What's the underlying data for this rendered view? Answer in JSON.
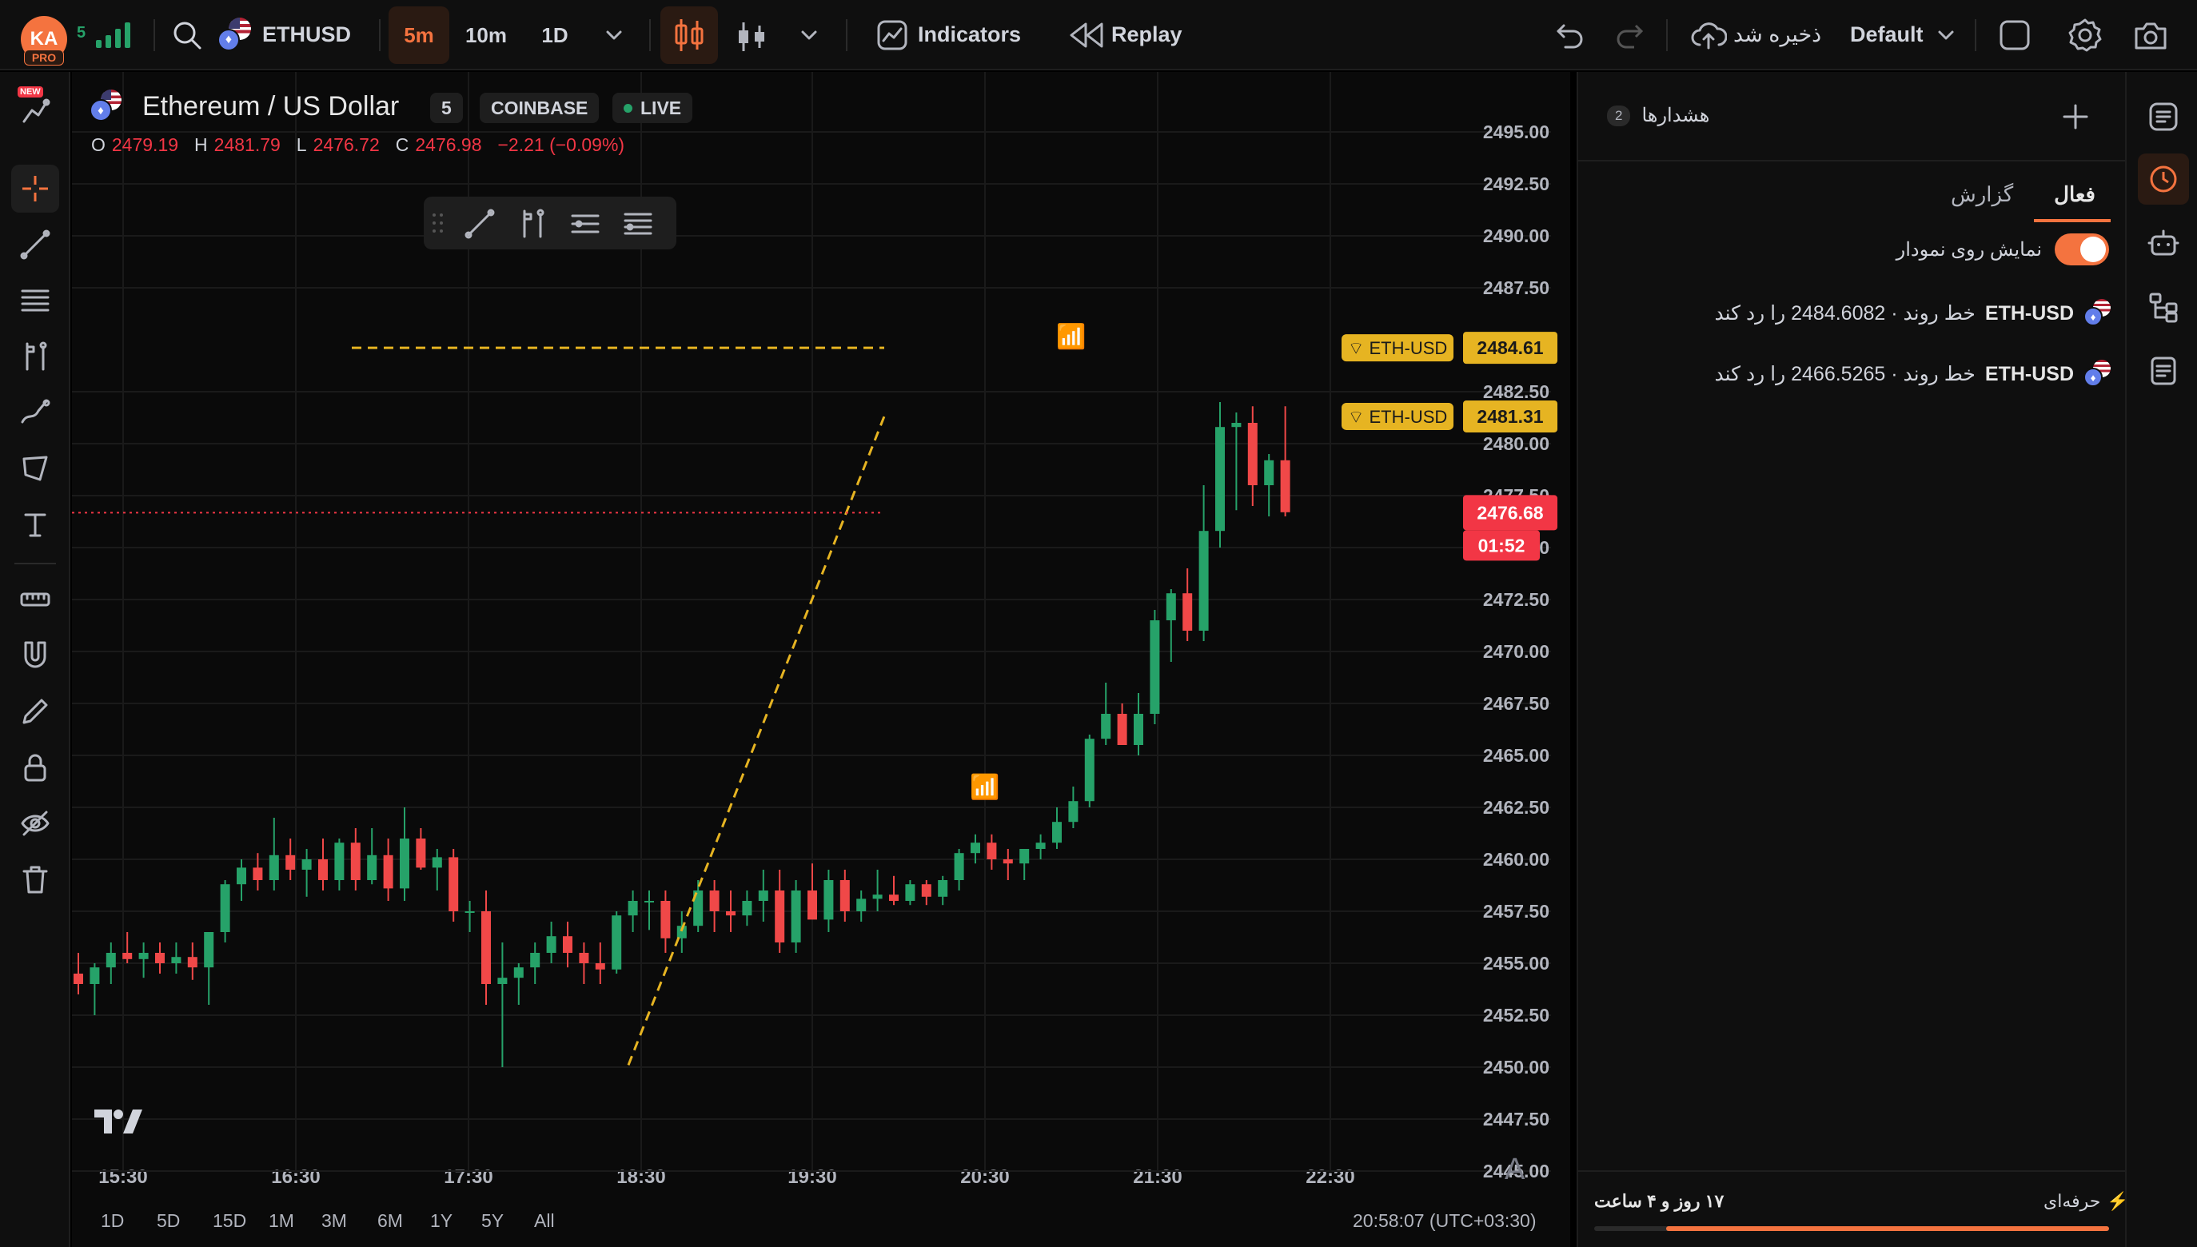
{
  "topbar": {
    "avatar_initials": "KA",
    "avatar_badge": "PRO",
    "signal_count": "5",
    "symbol": "ETHUSD",
    "intervals": [
      "5m",
      "10m",
      "1D"
    ],
    "indicators_label": "Indicators",
    "replay_label": "Replay",
    "save_label": "ذخیره شد",
    "layout_label": "Default"
  },
  "legend": {
    "title": "Ethereum / US Dollar",
    "interval": "5",
    "exchange": "COINBASE",
    "live": "LIVE",
    "o_label": "O",
    "o": "2479.19",
    "h_label": "H",
    "h": "2481.79",
    "l_label": "L",
    "l": "2476.72",
    "c_label": "C",
    "c": "2476.98",
    "change": "−2.21 (−0.09%)"
  },
  "chart_data": {
    "type": "candlestick",
    "y_ticks": [
      "2495.00",
      "2492.50",
      "2490.00",
      "2487.50",
      "2482.50",
      "2480.00",
      "2477.50",
      "2475.00",
      "2472.50",
      "2470.00",
      "2467.50",
      "2465.00",
      "2462.50",
      "2460.00",
      "2457.50",
      "2455.00",
      "2452.50",
      "2450.00",
      "2447.50",
      "2445.00"
    ],
    "y_tick_values": [
      2495,
      2492.5,
      2490,
      2487.5,
      2482.5,
      2480,
      2477.5,
      2475,
      2472.5,
      2470,
      2467.5,
      2465,
      2462.5,
      2460,
      2457.5,
      2455,
      2452.5,
      2450,
      2447.5,
      2445
    ],
    "x_ticks": [
      "15:30",
      "16:30",
      "17:30",
      "18:30",
      "19:30",
      "20:30",
      "21:30",
      "22:30"
    ],
    "ylim": [
      2443.5,
      2496.5
    ],
    "alert_lines": [
      {
        "label": "ETH-USD",
        "price": "2484.61",
        "value": 2484.61,
        "style": "horizontal"
      },
      {
        "label": "ETH-USD",
        "price": "2481.31",
        "value": 2481.31,
        "style": "trend"
      }
    ],
    "last_price": "2476.68",
    "countdown": "01:52",
    "candles": [
      [
        2454.5,
        2455.5,
        2453.5,
        2454
      ],
      [
        2454,
        2455,
        2452.5,
        2454.8
      ],
      [
        2454.8,
        2456,
        2454,
        2455.5
      ],
      [
        2455.5,
        2456.5,
        2455,
        2455.2
      ],
      [
        2455.2,
        2456,
        2454.3,
        2455.5
      ],
      [
        2455.5,
        2456,
        2454.5,
        2455
      ],
      [
        2455,
        2456,
        2454.5,
        2455.3
      ],
      [
        2455.3,
        2456,
        2454.2,
        2454.8
      ],
      [
        2454.8,
        2456.5,
        2453,
        2456.5
      ],
      [
        2456.5,
        2459,
        2456,
        2458.8
      ],
      [
        2458.8,
        2460,
        2458,
        2459.6
      ],
      [
        2459.6,
        2460.3,
        2458.5,
        2459
      ],
      [
        2459,
        2462,
        2458.5,
        2460.2
      ],
      [
        2460.2,
        2461,
        2459,
        2459.5
      ],
      [
        2459.5,
        2460.5,
        2458.2,
        2460
      ],
      [
        2460,
        2461,
        2458.5,
        2459
      ],
      [
        2459,
        2461,
        2458.5,
        2460.8
      ],
      [
        2460.8,
        2461.5,
        2458.5,
        2459
      ],
      [
        2459,
        2461.5,
        2458.8,
        2460.2
      ],
      [
        2460.2,
        2461,
        2458,
        2458.6
      ],
      [
        2458.6,
        2462.5,
        2458,
        2461
      ],
      [
        2461,
        2461.5,
        2459.5,
        2459.6
      ],
      [
        2459.6,
        2460.5,
        2458.5,
        2460.1
      ],
      [
        2460.1,
        2460.5,
        2457,
        2457.5
      ],
      [
        2457.5,
        2458,
        2456.5,
        2457.5
      ],
      [
        2457.5,
        2458.5,
        2453,
        2454
      ],
      [
        2454,
        2456,
        2450,
        2454.3
      ],
      [
        2454.3,
        2455,
        2453,
        2454.8
      ],
      [
        2454.8,
        2456,
        2454,
        2455.5
      ],
      [
        2455.5,
        2457,
        2455,
        2456.3
      ],
      [
        2456.3,
        2457,
        2454.8,
        2455.5
      ],
      [
        2455.5,
        2456,
        2454,
        2455
      ],
      [
        2455,
        2456,
        2454,
        2454.7
      ],
      [
        2454.7,
        2457.5,
        2454.5,
        2457.3
      ],
      [
        2457.3,
        2458.5,
        2456.5,
        2458
      ],
      [
        2458,
        2458.5,
        2456.6,
        2458
      ],
      [
        2458,
        2458.5,
        2455.5,
        2456.2
      ],
      [
        2456.2,
        2457.5,
        2455.5,
        2456.8
      ],
      [
        2456.8,
        2459,
        2456.5,
        2458.5
      ],
      [
        2458.5,
        2459,
        2456.5,
        2457.5
      ],
      [
        2457.5,
        2458.5,
        2456.5,
        2457.3
      ],
      [
        2457.3,
        2458.5,
        2456.8,
        2458
      ],
      [
        2458,
        2459.5,
        2457,
        2458.5
      ],
      [
        2458.5,
        2459.5,
        2455.5,
        2456
      ],
      [
        2456,
        2459,
        2455.5,
        2458.5
      ],
      [
        2458.5,
        2459.8,
        2458,
        2457.1
      ],
      [
        2457.1,
        2459.5,
        2456.5,
        2459
      ],
      [
        2459,
        2459.5,
        2457,
        2457.5
      ],
      [
        2457.5,
        2458.5,
        2457,
        2458.1
      ],
      [
        2458.1,
        2459.5,
        2457.5,
        2458.3
      ],
      [
        2458.3,
        2459.2,
        2457.8,
        2458
      ],
      [
        2458,
        2459,
        2457.8,
        2458.8
      ],
      [
        2458.8,
        2459,
        2457.8,
        2458.2
      ],
      [
        2458.2,
        2459.2,
        2457.8,
        2459
      ],
      [
        2459,
        2460.5,
        2458.5,
        2460.3
      ],
      [
        2460.3,
        2461.2,
        2459.8,
        2460.8
      ],
      [
        2460.8,
        2461.2,
        2459.5,
        2460
      ],
      [
        2460,
        2460.5,
        2459,
        2459.8
      ],
      [
        2459.8,
        2460.5,
        2459,
        2460.5
      ],
      [
        2460.5,
        2461.2,
        2460,
        2460.8
      ],
      [
        2460.8,
        2462.5,
        2460.5,
        2461.8
      ],
      [
        2461.8,
        2463.5,
        2461.5,
        2462.8
      ],
      [
        2462.8,
        2466,
        2462.5,
        2465.8
      ],
      [
        2465.8,
        2468.5,
        2465.5,
        2467
      ],
      [
        2467,
        2467.5,
        2465.5,
        2465.5
      ],
      [
        2465.5,
        2468,
        2465,
        2467
      ],
      [
        2467,
        2472,
        2466.5,
        2471.5
      ],
      [
        2471.5,
        2473,
        2469.5,
        2472.8
      ],
      [
        2472.8,
        2474,
        2470.5,
        2471
      ],
      [
        2471,
        2478,
        2470.5,
        2475.8
      ],
      [
        2475.8,
        2482,
        2475,
        2480.8
      ],
      [
        2480.8,
        2481.5,
        2476.8,
        2481
      ],
      [
        2481,
        2481.8,
        2477,
        2478
      ],
      [
        2478,
        2479.5,
        2476.5,
        2479.2
      ],
      [
        2479.2,
        2481.8,
        2476.5,
        2476.7
      ]
    ]
  },
  "chart": {
    "time_display": "20:58:07 (UTC+03:30)",
    "ranges": [
      "1D",
      "5D",
      "15D",
      "1M",
      "3M",
      "6M",
      "1Y",
      "5Y",
      "All"
    ],
    "auto_scale_label": "A"
  },
  "colors": {
    "up": "#26a269",
    "down": "#f04848",
    "accent": "#f4733f",
    "alert": "#e6b422",
    "price_line": "#f23645"
  },
  "alerts_panel": {
    "title": "هشدارها",
    "count": "2",
    "tab_active": "فعال",
    "tab_log": "گزارش",
    "show_on_chart": "نمایش روی نمودار",
    "items": [
      {
        "symbol": "ETH-USD",
        "text": "خط روند · 2484.6082 را رد کند"
      },
      {
        "symbol": "ETH-USD",
        "text": "خط روند · 2466.5265 را رد کند"
      }
    ],
    "footer_plan": "حرفه‌ای",
    "footer_remaining": "۱۷ روز و ۴ ساعت"
  }
}
